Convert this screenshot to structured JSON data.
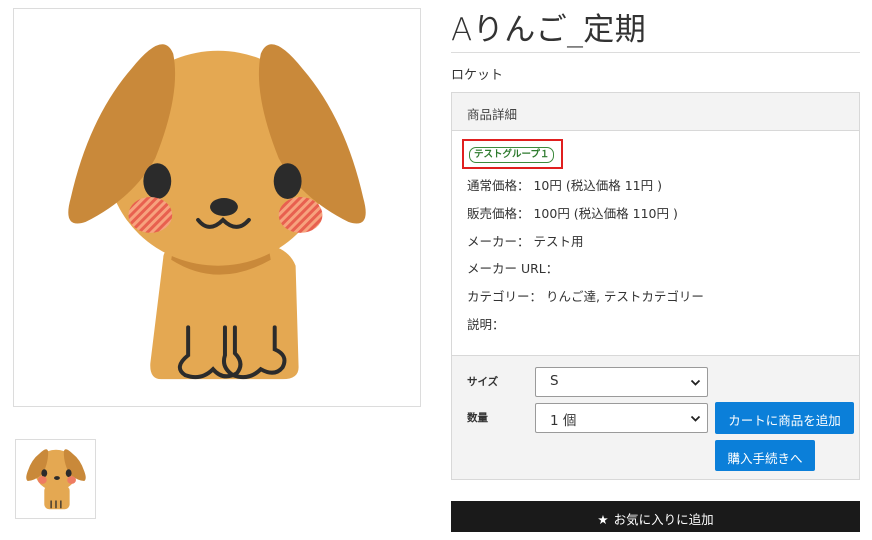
{
  "product": {
    "title": "Aりんご_定期",
    "maker_tag": "ロケット"
  },
  "detail": {
    "header": "商品詳細",
    "tag": "テストグループ１",
    "rows": [
      "通常価格： 10円  (税込価格 11円 )",
      "販売価格： 100円  (税込価格 110円 )",
      "メーカー： テスト用",
      "メーカー URL：",
      "カテゴリー： りんご達, テストカテゴリー",
      "説明："
    ]
  },
  "form": {
    "size_label": "サイズ",
    "size_value": "S",
    "qty_label": "数量",
    "qty_value": "1 個",
    "add_to_cart": "カートに商品を追加",
    "checkout": "購入手続きへ"
  },
  "favorite": {
    "label": "お気に入りに追加",
    "icon": "star-icon"
  },
  "images": {
    "main": "dog-illustration",
    "thumb": "dog-thumbnail"
  }
}
